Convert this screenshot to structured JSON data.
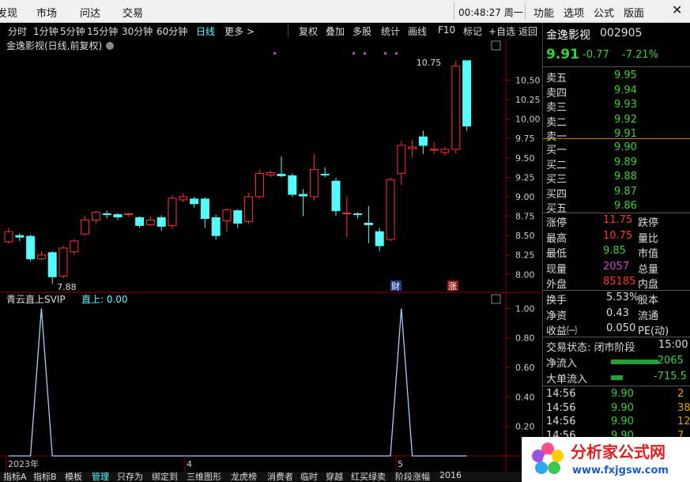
{
  "menu": [
    "发现",
    "市场",
    "问达",
    "交易"
  ],
  "clock": "00:48:27 周一",
  "menu_right": [
    "功能",
    "选项",
    "公式",
    "版面"
  ],
  "periods": [
    "分时",
    "1分钟",
    "5分钟",
    "15分钟",
    "30分钟",
    "60分钟",
    "日线",
    "更多 >"
  ],
  "active_period": "日线",
  "toolbar_buttons": [
    "复权",
    "叠加",
    "多股",
    "统计",
    "画线",
    "F10",
    "标记",
    "+自选",
    "返回"
  ],
  "chart_title": "金逸影视(日线,前复权)",
  "indicator_title": "青云直上SVIP",
  "indicator_value_label": "直上: 0.00",
  "colors": {
    "up": "#ff3232",
    "down": "#54fcfc",
    "line": "#a0d0ff",
    "accent": "#55ffff"
  },
  "chart_data": [
    {
      "type": "candlestick",
      "y_ticks": [
        10.5,
        10.25,
        10.0,
        9.75,
        9.5,
        9.25,
        9.0,
        8.75,
        8.5,
        8.25,
        8.0
      ],
      "ylim": [
        7.8,
        10.85
      ],
      "candles": [
        {
          "o": 8.42,
          "c": 8.55,
          "h": 8.6,
          "l": 8.4
        },
        {
          "o": 8.5,
          "c": 8.48,
          "h": 8.53,
          "l": 8.43
        },
        {
          "o": 8.49,
          "c": 8.2,
          "h": 8.51,
          "l": 8.17
        },
        {
          "o": 8.2,
          "c": 8.25,
          "h": 8.3,
          "l": 8.18
        },
        {
          "o": 8.28,
          "c": 7.97,
          "h": 8.3,
          "l": 7.88
        },
        {
          "o": 7.98,
          "c": 8.34,
          "h": 8.37,
          "l": 7.95
        },
        {
          "o": 8.29,
          "c": 8.43,
          "h": 8.46,
          "l": 8.25
        },
        {
          "o": 8.52,
          "c": 8.7,
          "h": 8.76,
          "l": 8.5
        },
        {
          "o": 8.7,
          "c": 8.8,
          "h": 8.82,
          "l": 8.65
        },
        {
          "o": 8.78,
          "c": 8.77,
          "h": 8.82,
          "l": 8.72
        },
        {
          "o": 8.77,
          "c": 8.74,
          "h": 8.79,
          "l": 8.7
        },
        {
          "o": 8.77,
          "c": 8.78,
          "h": 8.8,
          "l": 8.74
        },
        {
          "o": 8.73,
          "c": 8.63,
          "h": 8.75,
          "l": 8.6
        },
        {
          "o": 8.64,
          "c": 8.7,
          "h": 8.75,
          "l": 8.62
        },
        {
          "o": 8.73,
          "c": 8.62,
          "h": 8.76,
          "l": 8.56
        },
        {
          "o": 8.63,
          "c": 8.98,
          "h": 9.02,
          "l": 8.58
        },
        {
          "o": 8.96,
          "c": 9.0,
          "h": 9.05,
          "l": 8.93
        },
        {
          "o": 8.97,
          "c": 8.91,
          "h": 9.0,
          "l": 8.86
        },
        {
          "o": 8.97,
          "c": 8.72,
          "h": 8.99,
          "l": 8.6
        },
        {
          "o": 8.73,
          "c": 8.5,
          "h": 8.77,
          "l": 8.45
        },
        {
          "o": 8.69,
          "c": 8.83,
          "h": 8.85,
          "l": 8.55
        },
        {
          "o": 8.82,
          "c": 8.66,
          "h": 8.84,
          "l": 8.6
        },
        {
          "o": 8.68,
          "c": 9.0,
          "h": 9.05,
          "l": 8.65
        },
        {
          "o": 9.0,
          "c": 9.3,
          "h": 9.35,
          "l": 8.98
        },
        {
          "o": 9.28,
          "c": 9.31,
          "h": 9.34,
          "l": 9.25
        },
        {
          "o": 9.29,
          "c": 9.27,
          "h": 9.52,
          "l": 9.25
        },
        {
          "o": 9.27,
          "c": 9.03,
          "h": 9.3,
          "l": 9.0
        },
        {
          "o": 9.03,
          "c": 9.01,
          "h": 9.1,
          "l": 8.75
        },
        {
          "o": 9.0,
          "c": 9.35,
          "h": 9.55,
          "l": 8.95
        },
        {
          "o": 9.29,
          "c": 9.28,
          "h": 9.38,
          "l": 9.25
        },
        {
          "o": 9.2,
          "c": 8.82,
          "h": 9.24,
          "l": 8.75
        },
        {
          "o": 8.78,
          "c": 8.79,
          "h": 9.0,
          "l": 8.48
        },
        {
          "o": 8.78,
          "c": 8.77,
          "h": 8.8,
          "l": 8.72
        },
        {
          "o": 8.66,
          "c": 8.64,
          "h": 8.88,
          "l": 8.4
        },
        {
          "o": 8.55,
          "c": 8.37,
          "h": 8.6,
          "l": 8.3
        },
        {
          "o": 8.45,
          "c": 9.22,
          "h": 9.25,
          "l": 8.43
        },
        {
          "o": 9.3,
          "c": 9.66,
          "h": 9.72,
          "l": 9.15
        },
        {
          "o": 9.62,
          "c": 9.64,
          "h": 9.73,
          "l": 9.5
        },
        {
          "o": 9.77,
          "c": 9.66,
          "h": 9.85,
          "l": 9.55
        },
        {
          "o": 9.6,
          "c": 9.61,
          "h": 9.7,
          "l": 9.55
        },
        {
          "o": 9.57,
          "c": 9.61,
          "h": 9.64,
          "l": 9.53
        },
        {
          "o": 9.61,
          "c": 10.68,
          "h": 10.75,
          "l": 9.55
        },
        {
          "o": 10.75,
          "c": 9.91,
          "h": 10.75,
          "l": 9.85
        }
      ],
      "annotations": {
        "high_label": "10.75",
        "low_label": "7.88",
        "markers": [
          "财",
          "涨"
        ]
      },
      "x_labels": [
        "2023年",
        "4",
        "5"
      ]
    },
    {
      "type": "line",
      "name": "青云直上SVIP",
      "y_ticks": [
        1.0,
        0.8,
        0.6,
        0.4,
        0.2
      ],
      "ylim": [
        0,
        1.05
      ],
      "spikes": [
        {
          "index": 3,
          "value": 1.0
        },
        {
          "index": 36,
          "value": 1.0
        }
      ],
      "values": [
        0,
        0,
        0,
        1,
        0,
        0,
        0,
        0,
        0,
        0,
        0,
        0,
        0,
        0,
        0,
        0,
        0,
        0,
        0,
        0,
        0,
        0,
        0,
        0,
        0,
        0,
        0,
        0,
        0,
        0,
        0,
        0,
        0,
        0,
        0,
        0,
        1,
        0,
        0,
        0,
        0,
        0,
        0
      ]
    }
  ],
  "bottom_tabs": [
    "指标A",
    "指标B",
    "模板",
    "管理",
    "只存为",
    "绑定到",
    "三维图形",
    "龙虎榜",
    "消费者",
    "临时",
    "穿越",
    "红买绿卖",
    "阶段涨幅",
    "2016"
  ],
  "active_bottom_tab": "管理",
  "stock": {
    "name": "金逸影视",
    "code": "002905",
    "price": "9.91",
    "change": "-0.77",
    "pct": "-7.21%"
  },
  "sells": [
    {
      "label": "卖五",
      "price": "9.95"
    },
    {
      "label": "卖四",
      "price": "9.94"
    },
    {
      "label": "卖三",
      "price": "9.93"
    },
    {
      "label": "卖二",
      "price": "9.92"
    },
    {
      "label": "卖一",
      "price": "9.91"
    }
  ],
  "buys": [
    {
      "label": "买一",
      "price": "9.90"
    },
    {
      "label": "买二",
      "price": "9.89"
    },
    {
      "label": "买三",
      "price": "9.88"
    },
    {
      "label": "买四",
      "price": "9.87"
    },
    {
      "label": "买五",
      "price": "9.86"
    }
  ],
  "stats": [
    {
      "l": "涨停",
      "v": "11.75",
      "r": "跌停",
      "c": "#ff3232"
    },
    {
      "l": "最高",
      "v": "10.75",
      "r": "量比",
      "c": "#ff3232"
    },
    {
      "l": "最低",
      "v": "9.85",
      "r": "市值",
      "c": "#3ccf3c"
    },
    {
      "l": "现量",
      "v": "2057",
      "r": "总量",
      "c": "#d040d0"
    },
    {
      "l": "外盘",
      "v": "85185",
      "r": "内盘",
      "c": "#ff3232"
    }
  ],
  "stats2": [
    {
      "l": "换手",
      "v": "5.53%",
      "r": "股本"
    },
    {
      "l": "净资",
      "v": "0.43",
      "r": "流通"
    },
    {
      "l": "收益㈠",
      "v": "0.050",
      "r": "PE(动)"
    }
  ],
  "trade_status": "交易状态: 闭市阶段",
  "trade_time": "15:00",
  "flows": [
    {
      "l": "净流入",
      "v": "-2065",
      "w": 60
    },
    {
      "l": "大单流入",
      "v": "-715.5",
      "w": 15
    }
  ],
  "ticks": [
    {
      "t": "14:56",
      "p": "9.90",
      "v": "2"
    },
    {
      "t": "14:56",
      "p": "9.90",
      "v": "38"
    },
    {
      "t": "14:56",
      "p": "9.90",
      "v": "12"
    },
    {
      "t": "14:56",
      "p": "9.90",
      "v": "7"
    }
  ],
  "logo": {
    "text": "分析家公式网",
    "url": "www.fxjgsw.com"
  }
}
